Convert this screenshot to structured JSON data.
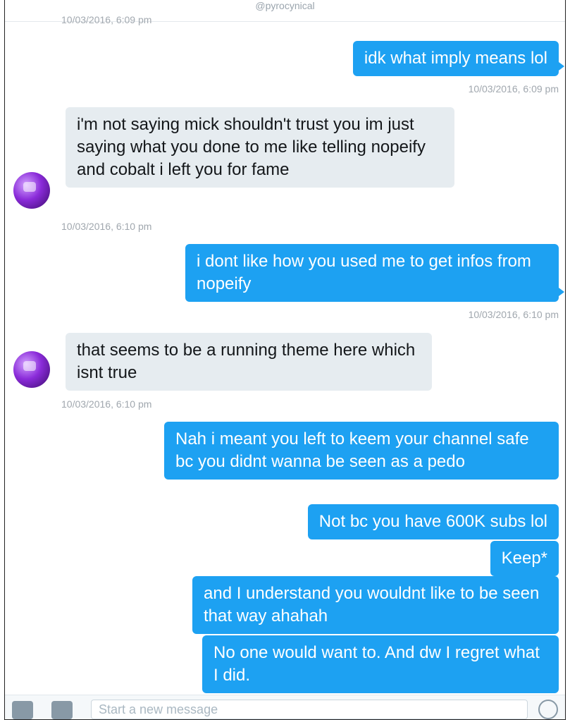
{
  "header": {
    "handle": "@pyrocynical",
    "previous_timestamp": "10/03/2016, 6:09 pm"
  },
  "messages": [
    {
      "dir": "out",
      "text": "idk what imply means lol",
      "time": "10/03/2016, 6:09 pm"
    },
    {
      "dir": "in",
      "text": "i'm not saying mick shouldn't trust you im just saying what you done to me like telling nopeify and cobalt i left you for fame",
      "time": "10/03/2016, 6:10 pm"
    },
    {
      "dir": "out",
      "text": "i dont like how you used me to get infos from nopeify",
      "time": "10/03/2016, 6:10 pm"
    },
    {
      "dir": "in",
      "text": "that seems to be a running theme here which isnt true",
      "time": "10/03/2016, 6:10 pm"
    },
    {
      "dir": "out",
      "text": "Nah i meant you left to keem your channel safe bc you didnt wanna be seen as a pedo"
    },
    {
      "dir": "out",
      "text": "Not bc you have 600K subs lol"
    },
    {
      "dir": "out",
      "text": "Keep*"
    },
    {
      "dir": "out",
      "text": "and I understand you wouldnt like to be seen that way ahahah"
    },
    {
      "dir": "out",
      "text": "No one would want to. And dw I regret what I did."
    }
  ],
  "composer": {
    "placeholder": "Start a new message"
  },
  "icons": [
    "camera-icon",
    "gif-icon",
    "emoji-icon",
    "avatar"
  ],
  "colors": {
    "outgoing": "#1da1f2",
    "incoming": "#e6ecf0",
    "timestamp": "#a0a7ae"
  }
}
